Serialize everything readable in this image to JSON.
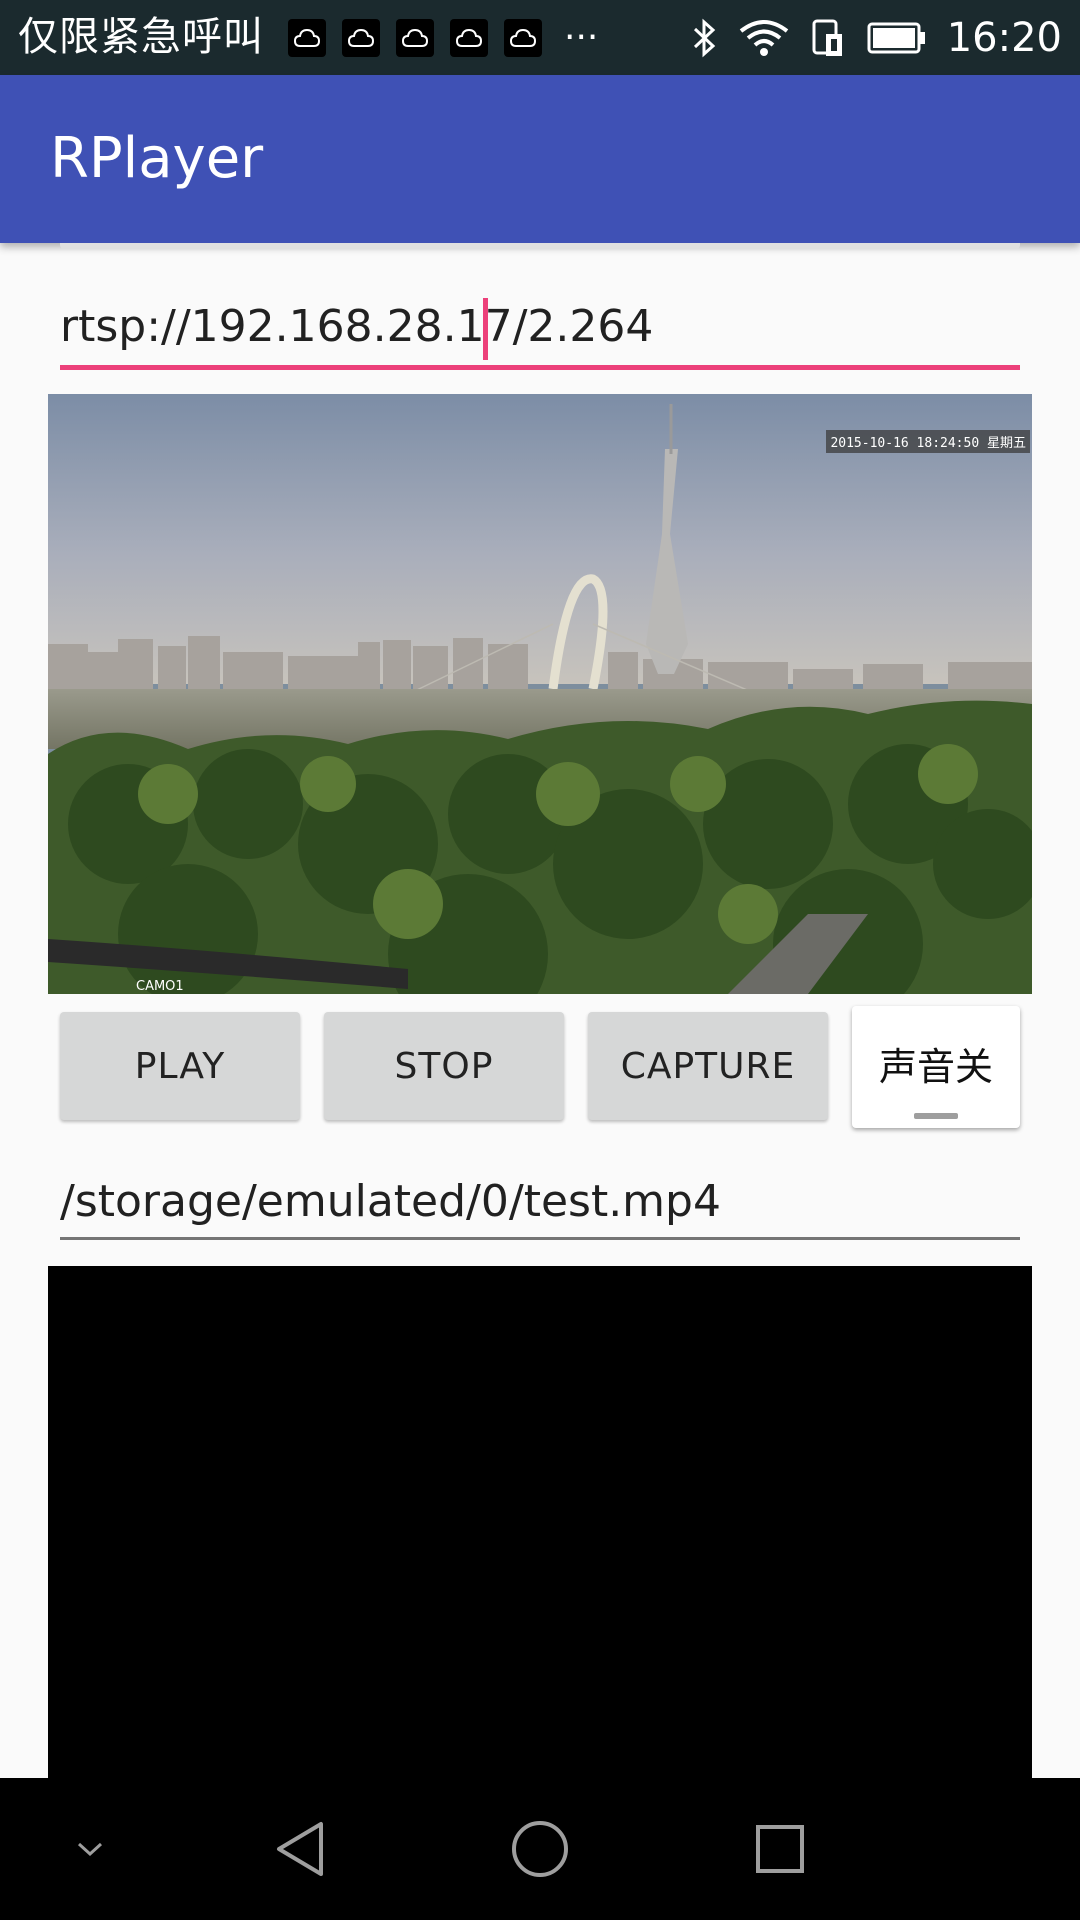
{
  "status_bar": {
    "carrier_text": "仅限紧急呼叫",
    "more_indicator": "···",
    "time": "16:20",
    "notification_icons": [
      "cloud-icon",
      "cloud-icon",
      "cloud-icon",
      "cloud-icon",
      "cloud-icon"
    ],
    "system_icons": [
      "bluetooth-icon",
      "wifi-icon",
      "sim-icon",
      "battery-icon"
    ]
  },
  "app_bar": {
    "title": "RPlayer",
    "color": "#3f51b5"
  },
  "url_input": {
    "value": "rtsp://192.168.28.17/2.264",
    "accent": "#ec407a"
  },
  "video": {
    "timestamp": "2015-10-16 18:24:50 星期五",
    "camera_label": "CAMO1"
  },
  "buttons": {
    "play": "PLAY",
    "stop": "STOP",
    "capture": "CAPTURE",
    "sound_toggle": "声音关"
  },
  "path_input": {
    "value": "/storage/emulated/0/test.mp4"
  },
  "nav_bar": {
    "icons": [
      "chevron-down-icon",
      "back-icon",
      "home-icon",
      "recents-icon"
    ]
  }
}
